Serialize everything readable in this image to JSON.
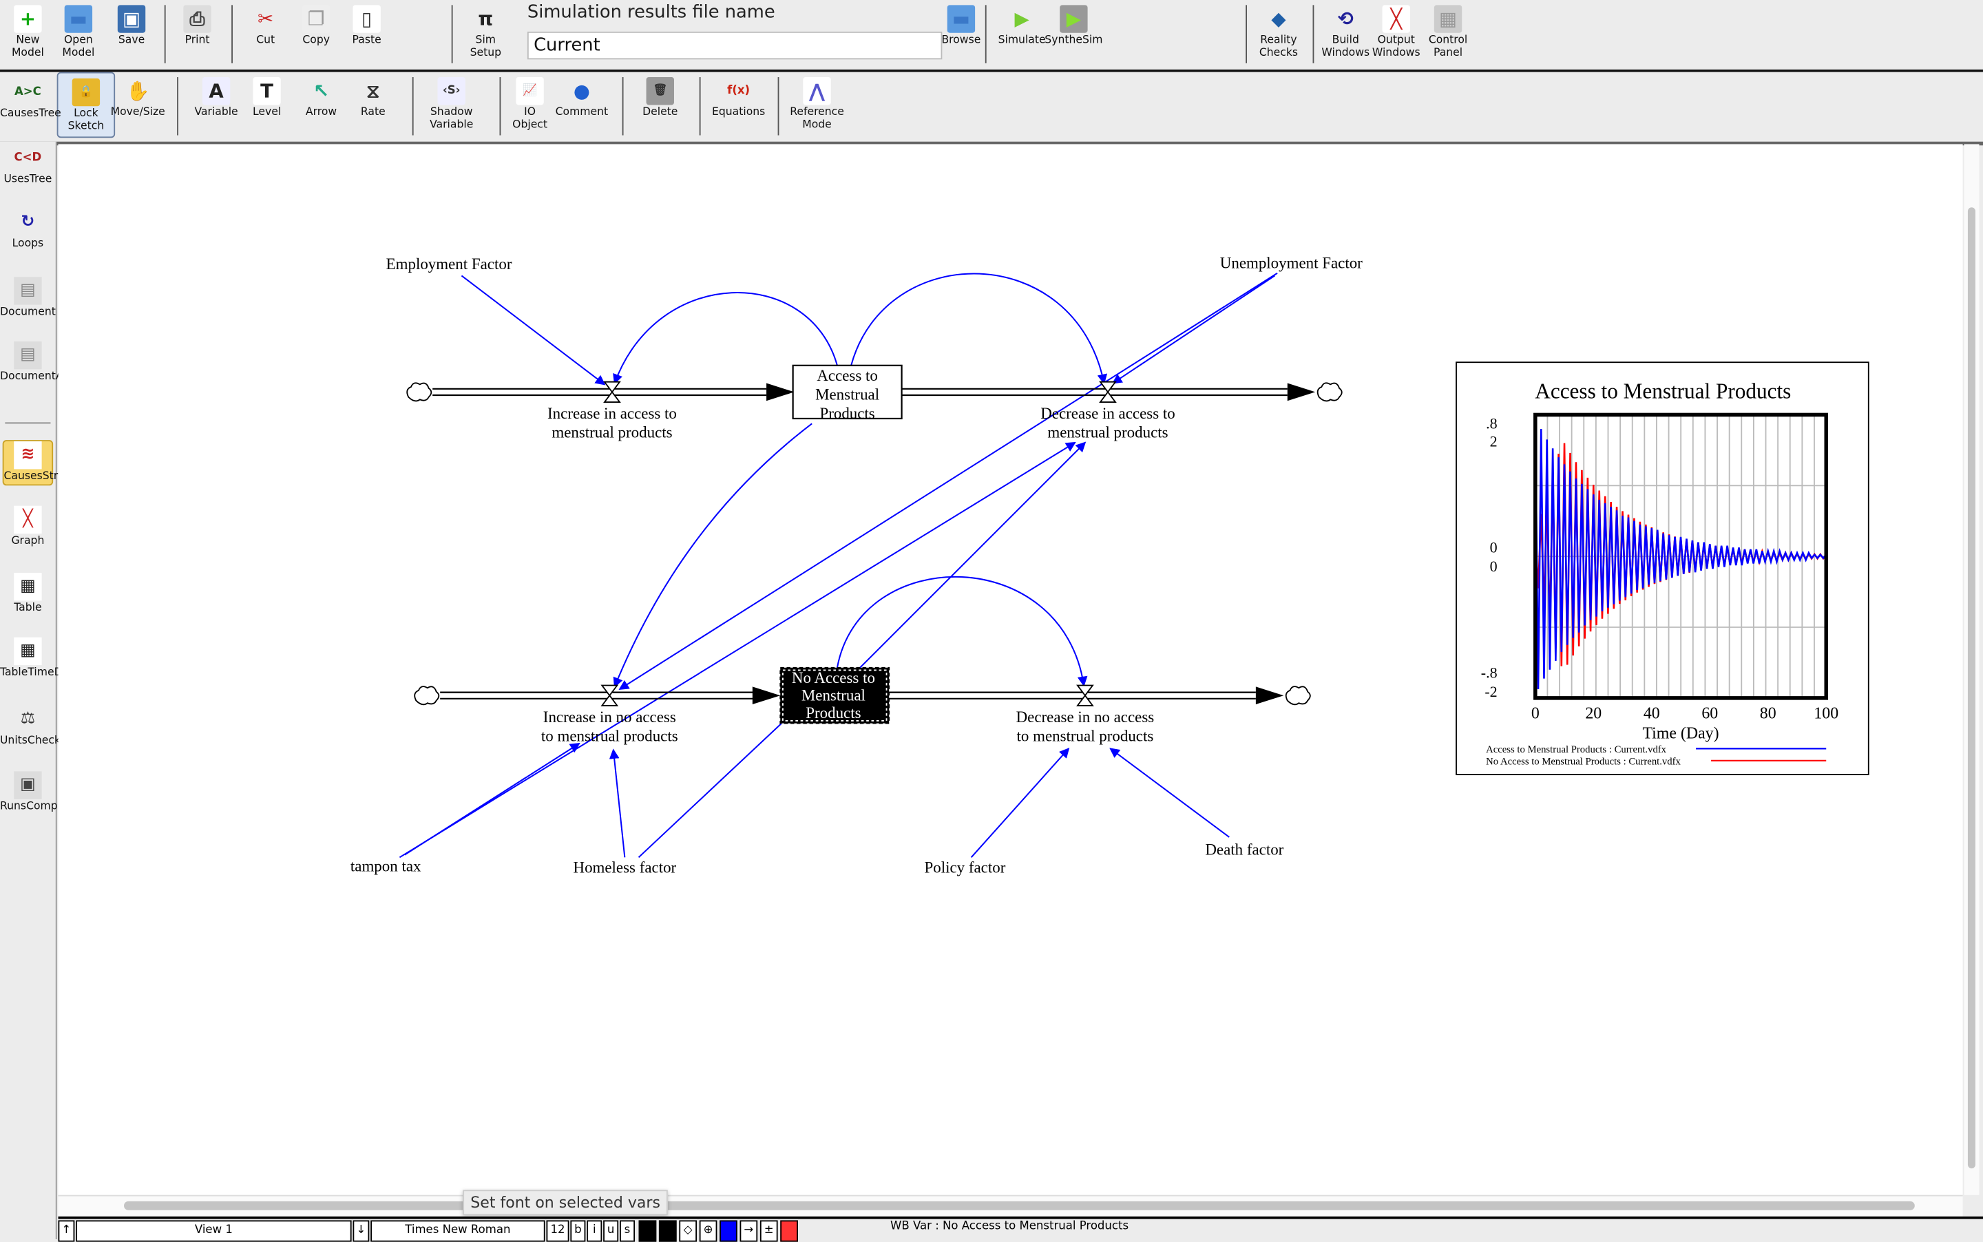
{
  "toolbar_top": {
    "items": [
      {
        "label": "New\nModel",
        "icon": "new-model-icon"
      },
      {
        "label": "Open\nModel",
        "icon": "folder-icon"
      },
      {
        "label": "Save",
        "icon": "floppy-disk-icon"
      },
      {
        "label": "Print",
        "icon": "printer-icon"
      },
      {
        "label": "Cut",
        "icon": "scissors-icon"
      },
      {
        "label": "Copy",
        "icon": "copy-icon"
      },
      {
        "label": "Paste",
        "icon": "clipboard-icon"
      },
      {
        "label": "Sim\nSetup",
        "icon": "pi-sim-setup-icon"
      },
      {
        "label": "Browse",
        "icon": "folder-icon"
      },
      {
        "label": "Simulate",
        "icon": "play-icon"
      },
      {
        "label": "SyntheSim",
        "icon": "synthesim-play-icon"
      },
      {
        "label": "Reality\nChecks",
        "icon": "check-diamond-icon"
      },
      {
        "label": "Build\nWindows",
        "icon": "build-windows-icon"
      },
      {
        "label": "Output\nWindows",
        "icon": "output-graph-icon"
      },
      {
        "label": "Control\nPanel",
        "icon": "control-panel-icon"
      }
    ],
    "sim_results_label": "Simulation results file name",
    "sim_results_value": "Current"
  },
  "toolbar_sketch": {
    "items": [
      {
        "label": "Lock\nSketch",
        "icon": "padlock-icon",
        "active": true
      },
      {
        "label": "Move/Size",
        "icon": "hand-icon"
      },
      {
        "label": "Variable",
        "icon": "variable-icon"
      },
      {
        "label": "Level",
        "icon": "level-box-icon"
      },
      {
        "label": "Arrow",
        "icon": "arrow-tool-icon"
      },
      {
        "label": "Rate",
        "icon": "rate-valve-icon"
      },
      {
        "label": "Shadow\nVariable",
        "icon": "shadow-variable-icon"
      },
      {
        "label": "IO\nObject",
        "icon": "io-object-icon"
      },
      {
        "label": "Comment",
        "icon": "comment-bubble-icon"
      },
      {
        "label": "Delete",
        "icon": "trash-icon"
      },
      {
        "label": "Equations",
        "icon": "fx-icon"
      },
      {
        "label": "Reference\nMode",
        "icon": "reference-mode-icon"
      }
    ]
  },
  "sidebar": {
    "items": [
      {
        "label": "Causes\nTree",
        "icon": "causes-tree-icon"
      },
      {
        "label": "Uses\nTree",
        "icon": "uses-tree-icon"
      },
      {
        "label": "Loops",
        "icon": "loops-icon"
      },
      {
        "label": "Document",
        "icon": "document-icon"
      },
      {
        "label": "Document\nAll",
        "icon": "document-all-icon"
      },
      {
        "label": "Causes\nStrip",
        "icon": "causes-strip-icon",
        "active": true
      },
      {
        "label": "Graph",
        "icon": "graph-icon"
      },
      {
        "label": "Table",
        "icon": "table-icon"
      },
      {
        "label": "Table\nTime\nDown",
        "icon": "table-time-down-icon"
      },
      {
        "label": "Units\nCheck",
        "icon": "scales-icon"
      },
      {
        "label": "Runs\nCompare",
        "icon": "runs-compare-icon"
      }
    ]
  },
  "diagram": {
    "stocks": {
      "access": [
        "Access to",
        "Menstrual",
        "Products"
      ],
      "no_access": [
        "No Access to",
        "Menstrual",
        "Products"
      ]
    },
    "rates": {
      "increase_access": [
        "Increase in access to",
        "menstrual products"
      ],
      "decrease_access": [
        "Decrease in access to",
        "menstrual products"
      ],
      "increase_no_access": [
        "Increase in no access",
        "to menstrual products"
      ],
      "decrease_no_access": [
        "Decrease in no access",
        "to menstrual products"
      ]
    },
    "auxiliaries": {
      "employment": "Employment Factor",
      "unemployment": "Unemployment Factor",
      "tampon_tax": "tampon tax",
      "homeless": "Homeless factor",
      "policy": "Policy factor",
      "death": "Death factor"
    },
    "link_color": "#0000ff",
    "selected_stock": "No Access to Menstrual Products"
  },
  "chart_data": {
    "type": "line",
    "title": "Access to Menstrual Products",
    "xlabel": "Time (Day)",
    "x_ticks": [
      "0",
      "20",
      "40",
      "60",
      "80",
      "100"
    ],
    "xlim": [
      0,
      100
    ],
    "y_tick_labels": {
      "top": [
        ".8",
        "2"
      ],
      "middle": [
        "0",
        "0"
      ],
      "bottom": [
        "-.8",
        "-2"
      ]
    },
    "grid": true,
    "legend_position": "bottom",
    "series": [
      {
        "name": "Access to Menstrual Products : Current.vdfx",
        "color": "#0000ff",
        "ylim": [
          -0.8,
          0.8
        ],
        "values": [
          0.78,
          -0.75,
          0.72,
          -0.69,
          0.66,
          -0.64,
          0.61,
          -0.59,
          0.56,
          -0.54,
          0.52,
          -0.5,
          0.48,
          -0.46,
          0.44,
          -0.43,
          0.41,
          -0.39,
          0.38,
          -0.36,
          0.35,
          -0.34,
          0.32,
          -0.31,
          0.3,
          -0.29,
          0.28,
          -0.27,
          0.26,
          -0.25,
          0.23,
          -0.23,
          0.22,
          -0.21,
          0.2,
          -0.19,
          0.18,
          -0.18,
          0.17,
          -0.16,
          0.16,
          -0.15,
          0.15,
          -0.14,
          0.13,
          -0.13,
          0.12,
          -0.12,
          0.11,
          -0.11,
          0.11,
          -0.1,
          0.1,
          -0.09,
          0.09,
          -0.09,
          0.08,
          -0.08,
          0.08,
          -0.07,
          0.07,
          -0.07,
          0.06,
          -0.06,
          0.06,
          -0.06,
          0.06,
          -0.05,
          0.05,
          -0.05,
          0.05,
          -0.05,
          0.04,
          -0.04,
          0.04,
          -0.04,
          0.04,
          -0.04,
          0.03,
          -0.03,
          0.03,
          -0.03,
          0.03,
          -0.03,
          0.03,
          -0.02,
          0.02,
          -0.02,
          0.02,
          -0.02,
          0.02,
          -0.02,
          0.02,
          -0.02,
          0.02,
          -0.01,
          0.01,
          -0.01,
          0.01,
          -0.01,
          0.01
        ]
      },
      {
        "name": "No Access to Menstrual Products : Current.vdfx",
        "color": "#ff0000",
        "ylim": [
          -2,
          2
        ],
        "values": [
          0.3,
          -0.45,
          0.6,
          -0.75,
          0.9,
          -1.05,
          1.2,
          -1.3,
          1.45,
          -1.55,
          1.6,
          -1.53,
          1.46,
          -1.4,
          1.33,
          -1.27,
          1.22,
          -1.16,
          1.11,
          -1.06,
          1.01,
          -0.97,
          0.93,
          -0.88,
          0.85,
          -0.81,
          0.77,
          -0.74,
          0.7,
          -0.67,
          0.64,
          -0.62,
          0.59,
          -0.56,
          0.54,
          -0.51,
          0.49,
          -0.47,
          0.45,
          -0.43,
          0.41,
          -0.39,
          0.37,
          -0.36,
          0.34,
          -0.33,
          0.31,
          -0.3,
          0.28,
          -0.27,
          0.26,
          -0.25,
          0.24,
          -0.23,
          0.22,
          -0.21,
          0.2,
          -0.19,
          0.18,
          -0.17,
          0.16,
          -0.16,
          0.15,
          -0.14,
          0.14,
          -0.13,
          0.13,
          -0.12,
          0.11,
          -0.11,
          0.11,
          -0.1,
          0.1,
          -0.09,
          0.09,
          -0.08,
          0.08,
          -0.08,
          0.07,
          -0.07,
          0.07,
          -0.06,
          0.06,
          -0.06,
          0.05,
          -0.05,
          0.05,
          -0.05,
          0.05,
          -0.04,
          0.04,
          -0.04,
          0.04,
          -0.04,
          0.04,
          -0.03,
          0.03,
          -0.03,
          0.03,
          -0.03,
          0.02
        ]
      }
    ]
  },
  "scrollbar_tooltip": "Set font on selected vars",
  "statusbar": {
    "view": "View 1",
    "font": "Times New Roman",
    "font_size": "12",
    "bold": "b",
    "italic": "i",
    "underline": "u",
    "strike": "s",
    "info": "WB Var : No Access to Menstrual Products"
  }
}
